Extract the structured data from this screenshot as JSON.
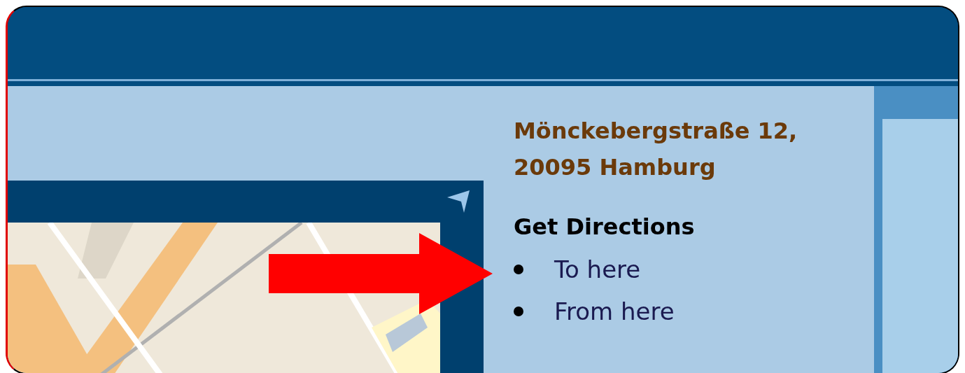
{
  "address_title": "Mönckebergstraße 12, 20095 Hamburg",
  "directions": {
    "heading": "Get Directions",
    "links": [
      {
        "label": "To here"
      },
      {
        "label": "From here"
      }
    ]
  }
}
